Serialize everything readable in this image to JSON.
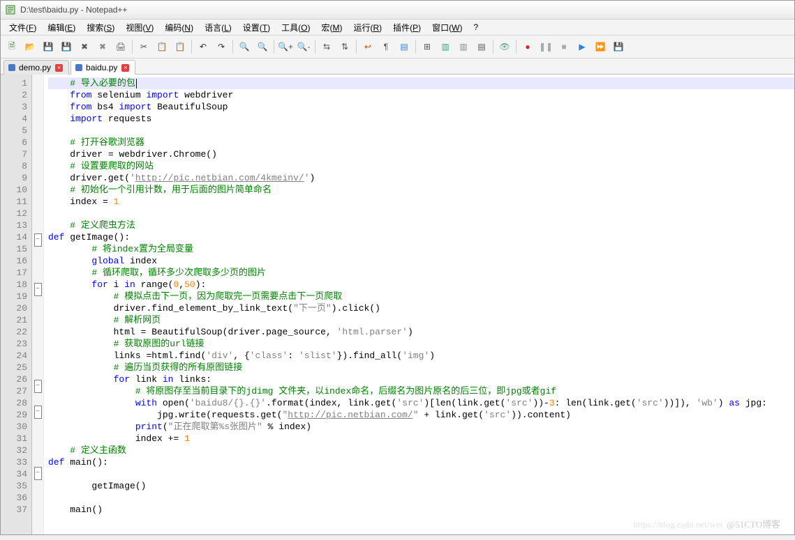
{
  "title": "D:\\test\\baidu.py - Notepad++",
  "menus": [
    "文件(F)",
    "编辑(E)",
    "搜索(S)",
    "视图(V)",
    "编码(N)",
    "语言(L)",
    "设置(T)",
    "工具(O)",
    "宏(M)",
    "运行(R)",
    "插件(P)",
    "窗口(W)"
  ],
  "help": "?",
  "toolbar_icons": [
    {
      "name": "new-file-icon",
      "glyph": "🗎",
      "color": "#3a7a38"
    },
    {
      "name": "open-file-icon",
      "glyph": "📂",
      "color": "#b59b00"
    },
    {
      "name": "save-icon",
      "glyph": "💾",
      "color": "#3a5fa8"
    },
    {
      "name": "save-all-icon",
      "glyph": "💾",
      "color": "#6a8fd8"
    },
    {
      "name": "close-icon",
      "glyph": "✖",
      "color": "#5a5a5a"
    },
    {
      "name": "close-all-icon",
      "glyph": "✖",
      "color": "#8a8a8a"
    },
    {
      "name": "print-icon",
      "glyph": "🖨",
      "color": "#666"
    },
    {
      "sep": true
    },
    {
      "name": "cut-icon",
      "glyph": "✂",
      "color": "#555"
    },
    {
      "name": "copy-icon",
      "glyph": "📋",
      "color": "#555"
    },
    {
      "name": "paste-icon",
      "glyph": "📋",
      "color": "#8a4"
    },
    {
      "sep": true
    },
    {
      "name": "undo-icon",
      "glyph": "↶",
      "color": "#333"
    },
    {
      "name": "redo-icon",
      "glyph": "↷",
      "color": "#333"
    },
    {
      "sep": true
    },
    {
      "name": "find-icon",
      "glyph": "🔍",
      "color": "#555"
    },
    {
      "name": "replace-icon",
      "glyph": "🔍",
      "color": "#a66"
    },
    {
      "sep": true
    },
    {
      "name": "zoom-in-icon",
      "glyph": "🔍+",
      "color": "#555"
    },
    {
      "name": "zoom-out-icon",
      "glyph": "🔍-",
      "color": "#555"
    },
    {
      "sep": true
    },
    {
      "name": "sync-v-icon",
      "glyph": "⇆",
      "color": "#555"
    },
    {
      "name": "sync-h-icon",
      "glyph": "⇅",
      "color": "#555"
    },
    {
      "sep": true
    },
    {
      "name": "word-wrap-icon",
      "glyph": "↩",
      "color": "#c05020"
    },
    {
      "name": "all-chars-icon",
      "glyph": "¶",
      "color": "#555"
    },
    {
      "name": "indent-guide-icon",
      "glyph": "▤",
      "color": "#2a82da"
    },
    {
      "sep": true
    },
    {
      "name": "lang-icon",
      "glyph": "⊞",
      "color": "#555"
    },
    {
      "name": "doc-map-icon",
      "glyph": "▥",
      "color": "#3a7"
    },
    {
      "name": "func-list-icon",
      "glyph": "▥",
      "color": "#888"
    },
    {
      "name": "folder-tree-icon",
      "glyph": "▤",
      "color": "#555"
    },
    {
      "sep": true
    },
    {
      "name": "monitor-icon",
      "glyph": "👁",
      "color": "#5a8"
    },
    {
      "sep": true
    },
    {
      "name": "record-start-icon",
      "glyph": "●",
      "color": "#d22"
    },
    {
      "name": "record-pause-icon",
      "glyph": "❚❚",
      "color": "#aaa"
    },
    {
      "name": "record-stop-icon",
      "glyph": "■",
      "color": "#aaa"
    },
    {
      "name": "playback-icon",
      "glyph": "▶",
      "color": "#2a82da"
    },
    {
      "name": "play-multi-icon",
      "glyph": "⏩",
      "color": "#2a82da"
    },
    {
      "name": "save-macro-icon",
      "glyph": "💾",
      "color": "#888"
    }
  ],
  "tabs": [
    {
      "label": "demo.py",
      "color": "#4a78c8",
      "active": false,
      "unsaved": true
    },
    {
      "label": "baidu.py",
      "color": "#4a78c8",
      "active": true,
      "unsaved": true
    }
  ],
  "lines": [
    {
      "n": 1,
      "current": true,
      "indent": 1,
      "tokens": [
        {
          "t": "# 导入必要的包",
          "c": "cm",
          "caret": true
        }
      ]
    },
    {
      "n": 2,
      "indent": 1,
      "tokens": [
        {
          "t": "from",
          "c": "kw"
        },
        {
          "t": " selenium ",
          "c": ""
        },
        {
          "t": "import",
          "c": "kw"
        },
        {
          "t": " webdriver",
          "c": ""
        }
      ]
    },
    {
      "n": 3,
      "indent": 1,
      "tokens": [
        {
          "t": "from",
          "c": "kw"
        },
        {
          "t": " bs4 ",
          "c": ""
        },
        {
          "t": "import",
          "c": "kw"
        },
        {
          "t": " BeautifulSoup",
          "c": ""
        }
      ]
    },
    {
      "n": 4,
      "indent": 1,
      "tokens": [
        {
          "t": "import",
          "c": "kw"
        },
        {
          "t": " requests",
          "c": ""
        }
      ]
    },
    {
      "n": 5,
      "indent": 1,
      "tokens": []
    },
    {
      "n": 6,
      "indent": 1,
      "tokens": [
        {
          "t": "# 打开谷歌浏览器",
          "c": "cm"
        }
      ]
    },
    {
      "n": 7,
      "indent": 1,
      "tokens": [
        {
          "t": "driver ",
          "c": ""
        },
        {
          "t": "=",
          "c": ""
        },
        {
          "t": " webdriver",
          "c": ""
        },
        {
          "t": ".",
          "c": ""
        },
        {
          "t": "Chrome",
          "c": ""
        },
        {
          "t": "()",
          "c": ""
        }
      ]
    },
    {
      "n": 8,
      "indent": 1,
      "tokens": [
        {
          "t": "# 设置要爬取的网站",
          "c": "cm"
        }
      ]
    },
    {
      "n": 9,
      "indent": 1,
      "tokens": [
        {
          "t": "driver",
          "c": ""
        },
        {
          "t": ".",
          "c": ""
        },
        {
          "t": "get",
          "c": ""
        },
        {
          "t": "(",
          "c": ""
        },
        {
          "t": "'",
          "c": "str"
        },
        {
          "t": "http://pic.netbian.com/4kmeinv/",
          "c": "url"
        },
        {
          "t": "'",
          "c": "str"
        },
        {
          "t": ")",
          "c": ""
        }
      ]
    },
    {
      "n": 10,
      "indent": 1,
      "tokens": [
        {
          "t": "# 初始化一个引用计数，用于后面的图片简单命名",
          "c": "cm"
        }
      ]
    },
    {
      "n": 11,
      "indent": 1,
      "tokens": [
        {
          "t": "index ",
          "c": ""
        },
        {
          "t": "=",
          "c": ""
        },
        {
          "t": " ",
          "c": ""
        },
        {
          "t": "1",
          "c": "num"
        }
      ]
    },
    {
      "n": 12,
      "indent": 1,
      "tokens": []
    },
    {
      "n": 13,
      "indent": 1,
      "tokens": [
        {
          "t": "# 定义爬虫方法",
          "c": "cm"
        }
      ]
    },
    {
      "n": 14,
      "fold": "open",
      "indent": 0,
      "tokens": [
        {
          "t": "def",
          "c": "kw"
        },
        {
          "t": " getImage",
          "c": ""
        },
        {
          "t": "():",
          "c": ""
        }
      ]
    },
    {
      "n": 15,
      "indent": 2,
      "tokens": [
        {
          "t": "# 将index置为全局变量",
          "c": "cm"
        }
      ]
    },
    {
      "n": 16,
      "indent": 2,
      "tokens": [
        {
          "t": "global",
          "c": "kw"
        },
        {
          "t": " index",
          "c": ""
        }
      ]
    },
    {
      "n": 17,
      "indent": 2,
      "tokens": [
        {
          "t": "# 循环爬取，循环多少次爬取多少页的图片",
          "c": "cm"
        }
      ]
    },
    {
      "n": 18,
      "fold": "open",
      "indent": 2,
      "tokens": [
        {
          "t": "for",
          "c": "kw"
        },
        {
          "t": " i ",
          "c": ""
        },
        {
          "t": "in",
          "c": "kw"
        },
        {
          "t": " range",
          "c": ""
        },
        {
          "t": "(",
          "c": ""
        },
        {
          "t": "0",
          "c": "num"
        },
        {
          "t": ",",
          "c": ""
        },
        {
          "t": "50",
          "c": "num"
        },
        {
          "t": "):",
          "c": ""
        }
      ]
    },
    {
      "n": 19,
      "indent": 3,
      "tokens": [
        {
          "t": "# 模拟点击下一页，因为爬取完一页需要点击下一页爬取",
          "c": "cm"
        }
      ]
    },
    {
      "n": 20,
      "indent": 3,
      "tokens": [
        {
          "t": "driver",
          "c": ""
        },
        {
          "t": ".",
          "c": ""
        },
        {
          "t": "find_element_by_link_text",
          "c": ""
        },
        {
          "t": "(",
          "c": ""
        },
        {
          "t": "\"下一页\"",
          "c": "str"
        },
        {
          "t": ")",
          "c": ""
        },
        {
          "t": ".",
          "c": ""
        },
        {
          "t": "click",
          "c": ""
        },
        {
          "t": "()",
          "c": ""
        }
      ]
    },
    {
      "n": 21,
      "indent": 3,
      "tokens": [
        {
          "t": "# 解析网页",
          "c": "cm"
        }
      ]
    },
    {
      "n": 22,
      "indent": 3,
      "tokens": [
        {
          "t": "html ",
          "c": ""
        },
        {
          "t": "=",
          "c": ""
        },
        {
          "t": " BeautifulSoup",
          "c": ""
        },
        {
          "t": "(",
          "c": ""
        },
        {
          "t": "driver",
          "c": ""
        },
        {
          "t": ".",
          "c": ""
        },
        {
          "t": "page_source",
          "c": ""
        },
        {
          "t": ", ",
          "c": ""
        },
        {
          "t": "'html.parser'",
          "c": "str"
        },
        {
          "t": ")",
          "c": ""
        }
      ]
    },
    {
      "n": 23,
      "indent": 3,
      "tokens": [
        {
          "t": "# 获取原图的url链接",
          "c": "cm"
        }
      ]
    },
    {
      "n": 24,
      "indent": 3,
      "tokens": [
        {
          "t": "links ",
          "c": ""
        },
        {
          "t": "=",
          "c": ""
        },
        {
          "t": "html",
          "c": ""
        },
        {
          "t": ".",
          "c": ""
        },
        {
          "t": "find",
          "c": ""
        },
        {
          "t": "(",
          "c": ""
        },
        {
          "t": "'div'",
          "c": "str"
        },
        {
          "t": ", ",
          "c": ""
        },
        {
          "t": "{",
          "c": ""
        },
        {
          "t": "'class'",
          "c": "str"
        },
        {
          "t": ": ",
          "c": ""
        },
        {
          "t": "'slist'",
          "c": "str"
        },
        {
          "t": "})",
          "c": ""
        },
        {
          "t": ".",
          "c": ""
        },
        {
          "t": "find_all",
          "c": ""
        },
        {
          "t": "(",
          "c": ""
        },
        {
          "t": "'img'",
          "c": "str"
        },
        {
          "t": ")",
          "c": ""
        }
      ]
    },
    {
      "n": 25,
      "indent": 3,
      "tokens": [
        {
          "t": "# 遍历当页获得的所有原图链接",
          "c": "cm"
        }
      ]
    },
    {
      "n": 26,
      "fold": "open",
      "indent": 3,
      "tokens": [
        {
          "t": "for",
          "c": "kw"
        },
        {
          "t": " link ",
          "c": ""
        },
        {
          "t": "in",
          "c": "kw"
        },
        {
          "t": " links:",
          "c": ""
        }
      ]
    },
    {
      "n": 27,
      "indent": 4,
      "tokens": [
        {
          "t": "# 将原图存至当前目录下的jdimg 文件夹，以index命名，后缀名为图片原名的后三位，即jpg或者gif",
          "c": "cm"
        }
      ]
    },
    {
      "n": 28,
      "fold": "open",
      "indent": 4,
      "tokens": [
        {
          "t": "with",
          "c": "kw"
        },
        {
          "t": " open",
          "c": ""
        },
        {
          "t": "(",
          "c": ""
        },
        {
          "t": "'baidu8/{}.{}'",
          "c": "str"
        },
        {
          "t": ".",
          "c": ""
        },
        {
          "t": "format",
          "c": ""
        },
        {
          "t": "(",
          "c": ""
        },
        {
          "t": "index",
          "c": ""
        },
        {
          "t": ", link.get(",
          "c": ""
        },
        {
          "t": "'src'",
          "c": "str"
        },
        {
          "t": ")[len(link.get(",
          "c": ""
        },
        {
          "t": "'src'",
          "c": "str"
        },
        {
          "t": "))-",
          "c": ""
        },
        {
          "t": "3",
          "c": "num"
        },
        {
          "t": ": len(link.get(",
          "c": ""
        },
        {
          "t": "'src'",
          "c": "str"
        },
        {
          "t": "))]), ",
          "c": ""
        },
        {
          "t": "'wb'",
          "c": "str"
        },
        {
          "t": ") ",
          "c": ""
        },
        {
          "t": "as",
          "c": "kw"
        },
        {
          "t": " jpg:",
          "c": ""
        }
      ]
    },
    {
      "n": 29,
      "indent": 5,
      "tokens": [
        {
          "t": "jpg.write(requests.get(",
          "c": ""
        },
        {
          "t": "\"",
          "c": "str"
        },
        {
          "t": "http://pic.netbian.com/",
          "c": "url"
        },
        {
          "t": "\"",
          "c": "str"
        },
        {
          "t": " + link.get(",
          "c": ""
        },
        {
          "t": "'src'",
          "c": "str"
        },
        {
          "t": ")).content)",
          "c": ""
        }
      ]
    },
    {
      "n": 30,
      "indent": 4,
      "tokens": [
        {
          "t": "print",
          "c": "kw"
        },
        {
          "t": "(",
          "c": ""
        },
        {
          "t": "\"正在爬取第%s张图片\"",
          "c": "str"
        },
        {
          "t": " % index)",
          "c": ""
        }
      ]
    },
    {
      "n": 31,
      "indent": 4,
      "tokens": [
        {
          "t": "index ",
          "c": ""
        },
        {
          "t": "+=",
          "c": ""
        },
        {
          "t": " ",
          "c": ""
        },
        {
          "t": "1",
          "c": "num"
        }
      ]
    },
    {
      "n": 32,
      "indent": 1,
      "tokens": [
        {
          "t": "# 定义主函数",
          "c": "cm"
        }
      ]
    },
    {
      "n": 33,
      "fold": "open",
      "indent": 0,
      "tokens": [
        {
          "t": "def",
          "c": "kw"
        },
        {
          "t": " main",
          "c": ""
        },
        {
          "t": "():",
          "c": ""
        }
      ]
    },
    {
      "n": 34,
      "indent": 1,
      "tokens": []
    },
    {
      "n": 35,
      "indent": 2,
      "tokens": [
        {
          "t": "getImage",
          "c": ""
        },
        {
          "t": "()",
          "c": ""
        }
      ]
    },
    {
      "n": 36,
      "indent": 1,
      "tokens": []
    },
    {
      "n": 37,
      "indent": 1,
      "tokens": [
        {
          "t": "main",
          "c": ""
        },
        {
          "t": "()",
          "c": ""
        }
      ]
    }
  ],
  "watermark": {
    "faint": "https://blog.csdn.net/wei",
    "label": "@51CTO博客"
  }
}
